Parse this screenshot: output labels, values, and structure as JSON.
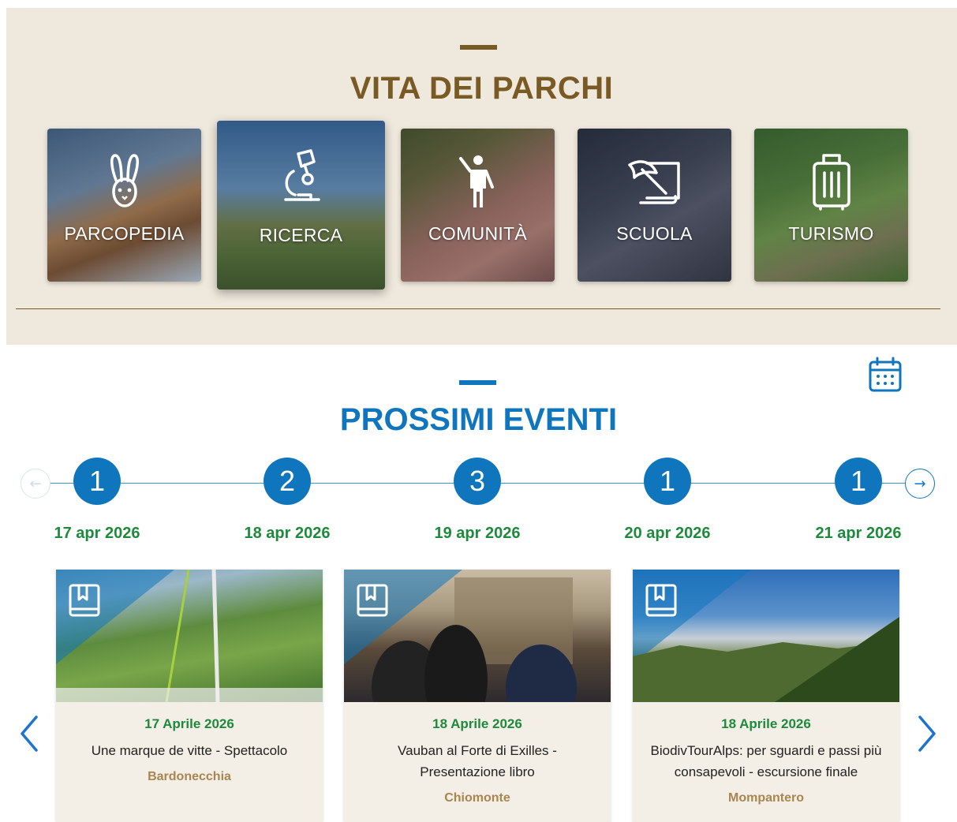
{
  "vita": {
    "title": "VITA DEI PARCHI",
    "tiles": [
      {
        "label": "PARCOPEDIA",
        "icon": "rabbit-icon"
      },
      {
        "label": "RICERCA",
        "icon": "microscope-icon"
      },
      {
        "label": "COMUNITÀ",
        "icon": "person-icon"
      },
      {
        "label": "SCUOLA",
        "icon": "quill-scroll-icon"
      },
      {
        "label": "TURISMO",
        "icon": "suitcase-icon"
      }
    ]
  },
  "eventi": {
    "title": "PROSSIMI EVENTI",
    "days": [
      {
        "count": "1",
        "date": "17 apr 2026"
      },
      {
        "count": "2",
        "date": "18 apr 2026"
      },
      {
        "count": "3",
        "date": "19 apr 2026"
      },
      {
        "count": "1",
        "date": "20 apr 2026"
      },
      {
        "count": "1",
        "date": "21 apr 2026"
      }
    ],
    "cards": [
      {
        "date": "17 Aprile 2026",
        "title": "Une marque de vitte - Spettacolo",
        "place": "Bardonecchia"
      },
      {
        "date": "18 Aprile 2026",
        "title": "Vauban al Forte di Exilles - Presentazione libro",
        "place": "Chiomonte"
      },
      {
        "date": "18 Aprile 2026",
        "title": "BiodivTourAlps: per sguardi e passi più consapevoli - escursione finale",
        "place": "Mompantero"
      }
    ]
  },
  "colors": {
    "brown": "#7a5a24",
    "blue": "#0f76bd",
    "green": "#1e8a3c",
    "gold": "#a88650",
    "beige": "#efe8dc"
  }
}
